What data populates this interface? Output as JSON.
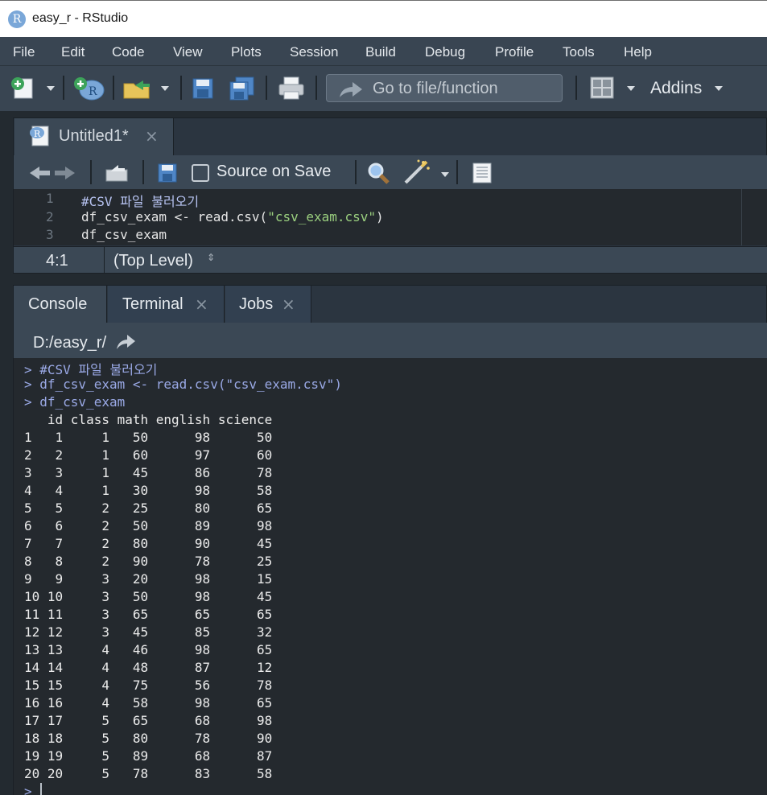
{
  "window": {
    "title": "easy_r - RStudio",
    "app_icon_letter": "R"
  },
  "menu": [
    "File",
    "Edit",
    "Code",
    "View",
    "Plots",
    "Session",
    "Build",
    "Debug",
    "Profile",
    "Tools",
    "Help"
  ],
  "toolbar": {
    "goto_placeholder": "Go to file/function",
    "addins_label": "Addins",
    "icons": [
      "new-file-icon",
      "new-project-icon",
      "open-file-icon",
      "save-icon",
      "save-all-icon",
      "print-icon",
      "pane-layout-icon"
    ]
  },
  "source": {
    "tab_label": "Untitled1*",
    "tab_close": "×",
    "source_on_save_label": "Source on Save",
    "source_on_save_checked": false,
    "lines": [
      {
        "num": "1",
        "text": "#CSV 파일 불러오기"
      },
      {
        "num": "2",
        "pre": "df_csv_exam <- read.csv(",
        "str": "\"csv_exam.csv\"",
        "post": ")"
      },
      {
        "num": "3",
        "text": "df_csv_exam"
      }
    ],
    "cursor_pos": "4:1",
    "scope": "(Top Level)",
    "scope_arrows": "⇕"
  },
  "console": {
    "tabs": [
      {
        "label": "Console",
        "closable": false
      },
      {
        "label": "Terminal",
        "closable": true
      },
      {
        "label": "Jobs",
        "closable": true
      }
    ],
    "close_glyph": "×",
    "path": "D:/easy_r/",
    "input_lines": [
      "> #CSV 파일 불러오기",
      "> df_csv_exam <- read.csv(\"csv_exam.csv\")",
      "> df_csv_exam"
    ],
    "table_header": "   id class math english science",
    "table_rows": [
      "1   1     1   50      98      50",
      "2   2     1   60      97      60",
      "3   3     1   45      86      78",
      "4   4     1   30      98      58",
      "5   5     2   25      80      65",
      "6   6     2   50      89      98",
      "7   7     2   80      90      45",
      "8   8     2   90      78      25",
      "9   9     3   20      98      15",
      "10 10     3   50      98      45",
      "11 11     3   65      65      65",
      "12 12     3   45      85      32",
      "13 13     4   46      98      65",
      "14 14     4   48      87      12",
      "15 15     4   75      56      78",
      "16 16     4   58      98      65",
      "17 17     5   65      68      98",
      "18 18     5   80      78      90",
      "19 19     5   89      68      87",
      "20 20     5   78      83      58"
    ],
    "prompt": ">"
  }
}
